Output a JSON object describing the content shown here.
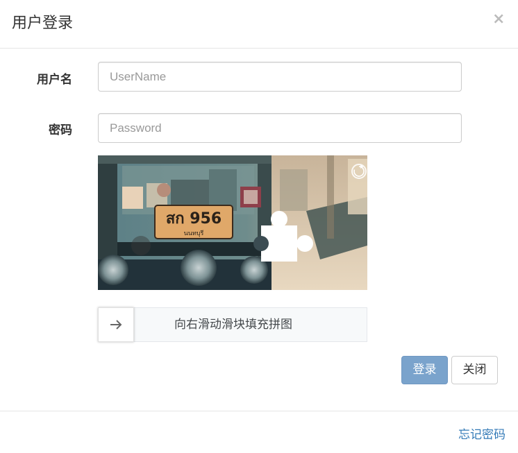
{
  "modal": {
    "title": "用户登录",
    "close_glyph": "×"
  },
  "form": {
    "username": {
      "label": "用户名",
      "placeholder": "UserName",
      "value": ""
    },
    "password": {
      "label": "密码",
      "placeholder": "Password",
      "value": ""
    }
  },
  "captcha": {
    "plate_text": "สก 956",
    "plate_subtext": "นนทบุรี",
    "refresh_icon": "refresh-icon",
    "slider_text": "向右滑动滑块填充拼图",
    "handle_icon": "arrow-right-icon"
  },
  "buttons": {
    "login_label": "登录",
    "close_label": "关闭"
  },
  "footer": {
    "forgot_label": "忘记密码"
  },
  "colors": {
    "primary_button": "#7aa3cc",
    "link": "#337ab7",
    "border": "#cccccc",
    "slider_bg": "#f7f9fa"
  }
}
